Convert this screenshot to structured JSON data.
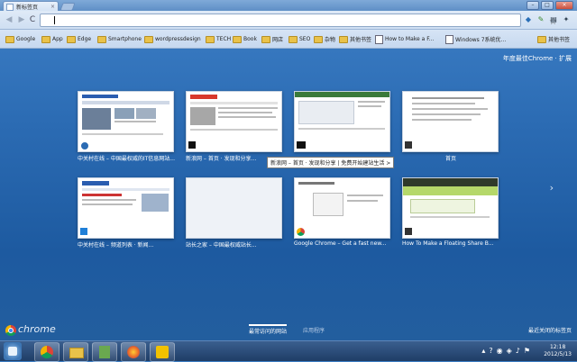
{
  "tab": {
    "title": "新标签页",
    "close": "×"
  },
  "window_controls": {
    "minimize": "–",
    "maximize": "□",
    "close": "×"
  },
  "toolbar": {
    "reload": "C",
    "star": "☆",
    "address_value": ""
  },
  "bookmarks": [
    {
      "label": "Google",
      "kind": "folder"
    },
    {
      "label": "App",
      "kind": "folder"
    },
    {
      "label": "Edge",
      "kind": "folder"
    },
    {
      "label": "Smartphone",
      "kind": "folder"
    },
    {
      "label": "wordpressdesign",
      "kind": "folder"
    },
    {
      "label": "TECH",
      "kind": "folder"
    },
    {
      "label": "Book",
      "kind": "folder"
    },
    {
      "label": "网店",
      "kind": "folder"
    },
    {
      "label": "SEO",
      "kind": "folder"
    },
    {
      "label": "杂物",
      "kind": "folder"
    },
    {
      "label": "其他书签",
      "kind": "folder"
    },
    {
      "label": "How to Make a F...",
      "kind": "page"
    },
    {
      "label": "Windows 7系统优...",
      "kind": "page"
    },
    {
      "label": "其他书签",
      "kind": "folder"
    }
  ],
  "promo": "年度最佳Chrome · 扩展",
  "tiles": [
    {
      "label": "中关村在线 – 中国最权威的IT信息网站..."
    },
    {
      "label": "新浪网 – 首页 · 发现和分享..."
    },
    {
      "label": ""
    },
    {
      "label": "首页"
    },
    {
      "label": "中关村在线 – 频道列表 · 新闻..."
    },
    {
      "label": "站长之家 – 中国最权威站长..."
    },
    {
      "label": "Google Chrome – Get a fast new..."
    },
    {
      "label": "How To Make a Floating Share B..."
    }
  ],
  "tooltip": "新浪网 – 首页 · 发现和分享 | 免费开始建站生活 >",
  "next_arrow": "›",
  "bottom": {
    "brand": "chrome",
    "tab_most_visited": "最常访问的网站",
    "tab_apps": "应用程序",
    "recently_closed": "最近关闭的标签页"
  },
  "taskbar": {
    "time": "12:18",
    "date": "2012/5/13"
  }
}
